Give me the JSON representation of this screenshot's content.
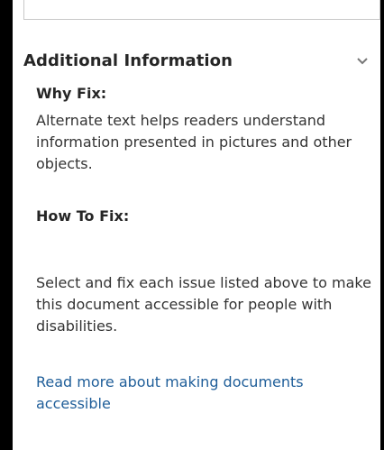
{
  "section": {
    "title": "Additional Information",
    "chevron_icon": "chevron-down-icon"
  },
  "why_fix": {
    "heading": "Why Fix:",
    "body": "Alternate text helps readers understand information presented in pictures and other objects."
  },
  "how_to_fix": {
    "heading": "How To Fix:",
    "body": "Select and fix each issue listed above to make this document accessible for people with disabilities."
  },
  "read_more_link": "Read more about making documents accessible",
  "colors": {
    "link": "#1f5e99",
    "heading_text": "#262626",
    "body_text": "#333333",
    "frame": "#000000"
  }
}
